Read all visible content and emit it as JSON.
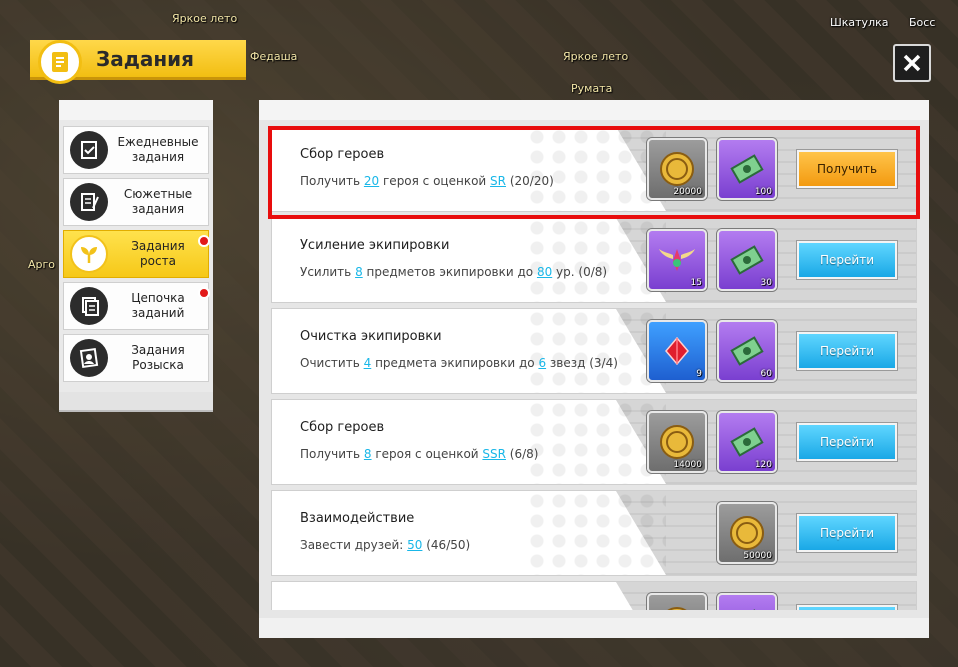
{
  "window": {
    "title": "Задания",
    "close_symbol": "✕"
  },
  "world_labels": [
    "Яркое лето",
    "Яркое лето",
    "Румата",
    "Федаша",
    "Арго",
    "Шкатулка",
    "Босс"
  ],
  "menu": {
    "items": [
      {
        "label": "Ежедневные\nзадания",
        "icon": "checklist-icon",
        "active": false,
        "badge": false
      },
      {
        "label": "Сюжетные\nзадания",
        "icon": "notebook-pen-icon",
        "active": false,
        "badge": false
      },
      {
        "label": "Задания роста",
        "icon": "sprout-icon",
        "active": true,
        "badge": true
      },
      {
        "label": "Цепочка\nзаданий",
        "icon": "scroll-stack-icon",
        "active": false,
        "badge": true
      },
      {
        "label": "Задания\nРозыска",
        "icon": "wanted-poster-icon",
        "active": false,
        "badge": false
      }
    ]
  },
  "quests": [
    {
      "title": "Сбор героев",
      "desc_parts": [
        "Получить ",
        "20",
        " героя с оценкой ",
        "SR",
        " (20/20)"
      ],
      "rewards": [
        {
          "type": "gold-coin-icon",
          "bg": "gray",
          "count": "20000"
        },
        {
          "type": "cash-stack-icon",
          "bg": "purple",
          "count": "100"
        }
      ],
      "button": "Получить",
      "button_kind": "claim"
    },
    {
      "title": "Усиление экипировки",
      "desc_parts": [
        "Усилить ",
        "8",
        " предметов экипировки до ",
        "80",
        " ур. (0/8)"
      ],
      "rewards": [
        {
          "type": "winged-emblem-icon",
          "bg": "purple",
          "count": "15"
        },
        {
          "type": "cash-stack-icon",
          "bg": "purple",
          "count": "30"
        }
      ],
      "button": "Перейти",
      "button_kind": "go"
    },
    {
      "title": "Очистка экипировки",
      "desc_parts": [
        "Очистить ",
        "4",
        " предмета экипировки до ",
        "6",
        " звезд (3/4)"
      ],
      "rewards": [
        {
          "type": "red-gem-icon",
          "bg": "blue",
          "count": "9"
        },
        {
          "type": "cash-stack-icon",
          "bg": "purple",
          "count": "60"
        }
      ],
      "button": "Перейти",
      "button_kind": "go"
    },
    {
      "title": "Сбор героев",
      "desc_parts": [
        "Получить ",
        "8",
        " героя с оценкой ",
        "SSR",
        " (6/8)"
      ],
      "rewards": [
        {
          "type": "gold-coin-icon",
          "bg": "gray",
          "count": "14000"
        },
        {
          "type": "cash-stack-icon",
          "bg": "purple",
          "count": "120"
        }
      ],
      "button": "Перейти",
      "button_kind": "go"
    },
    {
      "title": "Взаимодействие",
      "desc_parts": [
        "Завести друзей: ",
        "50",
        " (46/50)",
        "",
        ""
      ],
      "rewards": [
        {
          "type": "gold-coin-icon",
          "bg": "gray",
          "count": "50000"
        }
      ],
      "button": "Перейти",
      "button_kind": "go"
    },
    {
      "title": "",
      "desc_parts": [
        "",
        "",
        "",
        "",
        ""
      ],
      "rewards": [
        {
          "type": "gold-coin-icon",
          "bg": "gray",
          "count": ""
        },
        {
          "type": "cash-stack-icon",
          "bg": "purple",
          "count": ""
        }
      ],
      "button": "",
      "button_kind": "go"
    }
  ],
  "colors": {
    "accent_yellow": "#f6c818",
    "link_blue": "#19b7e8",
    "go_button": "#1aa8e6",
    "claim_button": "#f39a10",
    "highlight_red": "#e80d0d"
  }
}
